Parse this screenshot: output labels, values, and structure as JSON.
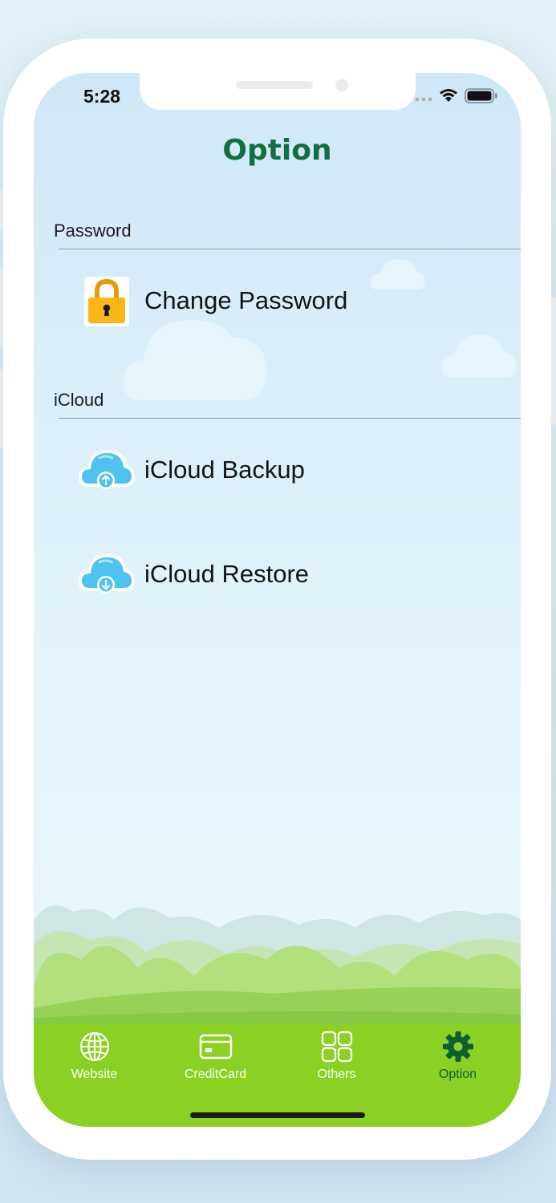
{
  "status_bar": {
    "time": "5:28"
  },
  "header": {
    "title": "Option"
  },
  "sections": [
    {
      "label": "Password",
      "items": [
        {
          "label": "Change Password",
          "icon": "lock-icon"
        }
      ]
    },
    {
      "label": "iCloud",
      "items": [
        {
          "label": "iCloud Backup",
          "icon": "cloud-upload-icon"
        },
        {
          "label": "iCloud Restore",
          "icon": "cloud-download-icon"
        }
      ]
    }
  ],
  "tabbar": {
    "tabs": [
      {
        "label": "Website",
        "icon": "globe-icon",
        "active": false
      },
      {
        "label": "CreditCard",
        "icon": "credit-card-icon",
        "active": false
      },
      {
        "label": "Others",
        "icon": "grid-icon",
        "active": false
      },
      {
        "label": "Option",
        "icon": "gear-icon",
        "active": true
      }
    ],
    "active_color": "#0d5f33",
    "background_color": "#8ad124"
  },
  "colors": {
    "title": "#11703f",
    "lock_body": "#f8b619",
    "cloud": "#4fc3ef"
  }
}
